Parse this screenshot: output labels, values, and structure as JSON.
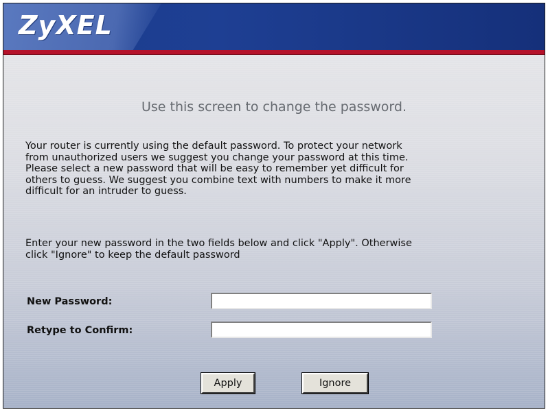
{
  "header": {
    "logo_text": "ZyXEL"
  },
  "main": {
    "heading": "Use this screen to change the password.",
    "intro_lines": [
      "Your router is currently using the default password. To protect your network",
      "from unauthorized users we suggest you change your password at this time.",
      "Please select a new password that will be easy to remember yet difficult for",
      "others to guess. We suggest you combine text with numbers to make it more",
      "difficult for an intruder to guess."
    ],
    "instruction_lines": [
      "Enter your new password in the two fields below and click \"Apply\". Otherwise",
      "click \"Ignore\" to keep the default password"
    ]
  },
  "form": {
    "new_password": {
      "label": "New Password:",
      "value": ""
    },
    "confirm_password": {
      "label": "Retype to Confirm:",
      "value": ""
    }
  },
  "buttons": {
    "apply_label": "Apply",
    "ignore_label": "Ignore"
  },
  "colors": {
    "header_blue": "#1e3f93",
    "header_red_stripe": "#b5122a",
    "heading_gray": "#666a70"
  }
}
